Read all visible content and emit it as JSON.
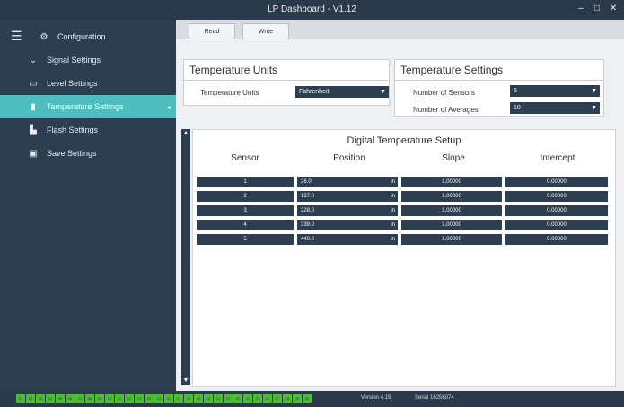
{
  "window": {
    "title": "LP Dashboard - V1.12"
  },
  "sidebar": {
    "items": [
      {
        "label": "Configuration",
        "icon": "gear-icon"
      },
      {
        "label": "Signal Settings",
        "icon": "chevron-down-icon"
      },
      {
        "label": "Level Settings",
        "icon": "level-icon"
      },
      {
        "label": "Temperature Settings",
        "icon": "thermometer-icon"
      },
      {
        "label": "Flash Settings",
        "icon": "flash-icon"
      },
      {
        "label": "Save Settings",
        "icon": "save-icon"
      }
    ]
  },
  "toolbar": {
    "read_label": "Read",
    "write_label": "Write"
  },
  "temperature_units": {
    "title": "Temperature Units",
    "field_label": "Temperature Units",
    "value": "Fahrenheit"
  },
  "temperature_settings": {
    "title": "Temperature Settings",
    "sensors_label": "Number of Sensors",
    "sensors_value": "5",
    "averages_label": "Number of Averages",
    "averages_value": "10"
  },
  "digital_temperature_setup": {
    "title": "Digital Temperature Setup",
    "columns": [
      "Sensor",
      "Position",
      "Slope",
      "Intercept"
    ],
    "rows": [
      {
        "sensor": "1",
        "position": "26.0",
        "unit": "in",
        "slope": "1.00000",
        "intercept": "0.00000"
      },
      {
        "sensor": "2",
        "position": "137.0",
        "unit": "in",
        "slope": "1.00000",
        "intercept": "0.00000"
      },
      {
        "sensor": "3",
        "position": "228.0",
        "unit": "in",
        "slope": "1.00000",
        "intercept": "0.00000"
      },
      {
        "sensor": "4",
        "position": "339.0",
        "unit": "in",
        "slope": "1.00000",
        "intercept": "0.00000"
      },
      {
        "sensor": "5",
        "position": "440.0",
        "unit": "in",
        "slope": "1.00000",
        "intercept": "0.00000"
      }
    ]
  },
  "status": {
    "chips": [
      "01",
      "02",
      "03",
      "04",
      "05",
      "06",
      "07",
      "08",
      "09",
      "10",
      "11",
      "12",
      "13",
      "14",
      "15",
      "16",
      "17",
      "18",
      "19",
      "20",
      "21",
      "22",
      "23",
      "24",
      "25",
      "26",
      "27",
      "28",
      "29",
      "30"
    ],
    "chip_color": "#4fba3c",
    "version_label": "Version",
    "version_value": "4.15",
    "serial_label": "Serial",
    "serial_value": "16258074"
  },
  "colors": {
    "sidebar_bg": "#2c3e50",
    "active_item": "#4dbdbd",
    "field_bg": "#2c3e50"
  }
}
